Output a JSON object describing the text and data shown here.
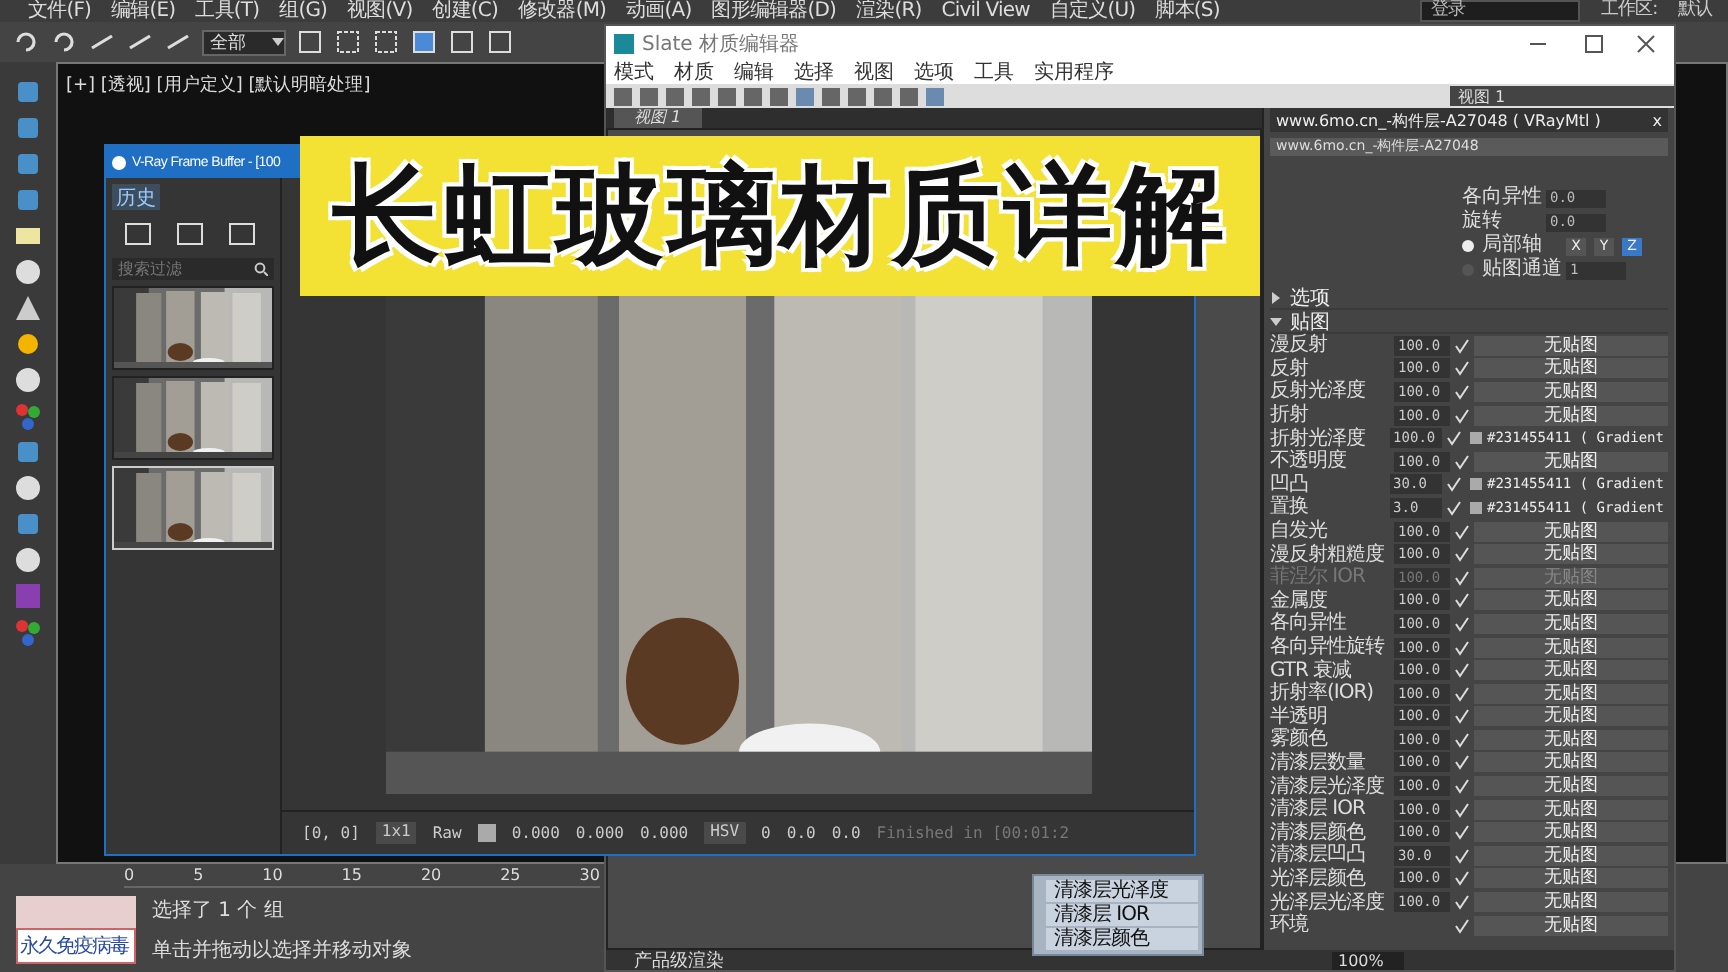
{
  "menu_bar": [
    "文件(F)",
    "编辑(E)",
    "工具(T)",
    "组(G)",
    "视图(V)",
    "创建(C)",
    "修改器(M)",
    "动画(A)",
    "图形编辑器(D)",
    "渲染(R)",
    "Civil View",
    "自定义(U)",
    "脚本(S)"
  ],
  "login_field": {
    "placeholder": "登录"
  },
  "workspace": {
    "label": "工作区:",
    "value": "默认"
  },
  "toolbar": {
    "selection_filter": "全部"
  },
  "viewport": {
    "label": "[+] [透视] [用户定义] [默认明暗处理]"
  },
  "slate_editor": {
    "title": "Slate 材质编辑器",
    "menu": [
      "模式",
      "材质",
      "编辑",
      "选择",
      "视图",
      "选项",
      "工具",
      "实用程序"
    ],
    "view_select": "视图 1",
    "tabs": [
      {
        "label": "视图 1",
        "selected": true
      }
    ],
    "node_rows": [
      "清漆层光泽度",
      "清漆层 IOR",
      "清漆层颜色"
    ],
    "render_mode": "产品级渲染",
    "zoom": "100%",
    "params": {
      "title": "www.6mo.cn_-构件层-A27048 ( VRayMtl )",
      "close": "x",
      "name": "www.6mo.cn_-构件层-A27048",
      "fields": [
        {
          "label": "各向异性",
          "value": "0.0"
        },
        {
          "label": "旋转",
          "value": "0.0"
        }
      ],
      "axis_options": [
        {
          "label": "局部轴",
          "selected": true
        },
        {
          "label": "贴图通道",
          "selected": false
        }
      ],
      "channel": "1",
      "axes": [
        {
          "label": "X",
          "selected": false
        },
        {
          "label": "Y",
          "selected": false
        },
        {
          "label": "Z",
          "selected": true
        }
      ],
      "sections": [
        {
          "title": "选项",
          "expanded": false
        },
        {
          "title": "贴图",
          "expanded": true
        }
      ],
      "maps": [
        {
          "name": "漫反射",
          "amount": "100.0",
          "checked": true,
          "kind": "empty",
          "map": "无贴图",
          "disabled": false
        },
        {
          "name": "反射",
          "amount": "100.0",
          "checked": true,
          "kind": "empty",
          "map": "无贴图",
          "disabled": false
        },
        {
          "name": "反射光泽度",
          "amount": "100.0",
          "checked": true,
          "kind": "empty",
          "map": "无贴图",
          "disabled": false
        },
        {
          "name": "折射",
          "amount": "100.0",
          "checked": true,
          "kind": "empty",
          "map": "无贴图",
          "disabled": false
        },
        {
          "name": "折射光泽度",
          "amount": "100.0",
          "checked": true,
          "kind": "texture",
          "map": "#231455411 ( Gradient",
          "disabled": false
        },
        {
          "name": "不透明度",
          "amount": "100.0",
          "checked": true,
          "kind": "empty",
          "map": "无贴图",
          "disabled": false
        },
        {
          "name": "凹凸",
          "amount": "30.0",
          "checked": true,
          "kind": "texture",
          "map": "#231455411 ( Gradient",
          "disabled": false
        },
        {
          "name": "置换",
          "amount": "3.0",
          "checked": true,
          "kind": "texture",
          "map": "#231455411 ( Gradient",
          "disabled": false
        },
        {
          "name": "自发光",
          "amount": "100.0",
          "checked": true,
          "kind": "empty",
          "map": "无贴图",
          "disabled": false
        },
        {
          "name": "漫反射粗糙度",
          "amount": "100.0",
          "checked": true,
          "kind": "empty",
          "map": "无贴图",
          "disabled": false
        },
        {
          "name": "菲涅尔 IOR",
          "amount": "100.0",
          "checked": true,
          "kind": "empty",
          "map": "无贴图",
          "disabled": true
        },
        {
          "name": "金属度",
          "amount": "100.0",
          "checked": true,
          "kind": "empty",
          "map": "无贴图",
          "disabled": false
        },
        {
          "name": "各向异性",
          "amount": "100.0",
          "checked": true,
          "kind": "empty",
          "map": "无贴图",
          "disabled": false
        },
        {
          "name": "各向异性旋转",
          "amount": "100.0",
          "checked": true,
          "kind": "empty",
          "map": "无贴图",
          "disabled": false
        },
        {
          "name": "GTR 衰减",
          "amount": "100.0",
          "checked": true,
          "kind": "empty",
          "map": "无贴图",
          "disabled": false
        },
        {
          "name": "折射率(IOR)",
          "amount": "100.0",
          "checked": true,
          "kind": "empty",
          "map": "无贴图",
          "disabled": false
        },
        {
          "name": "半透明",
          "amount": "100.0",
          "checked": true,
          "kind": "empty",
          "map": "无贴图",
          "disabled": false
        },
        {
          "name": "雾颜色",
          "amount": "100.0",
          "checked": true,
          "kind": "empty",
          "map": "无贴图",
          "disabled": false
        },
        {
          "name": "清漆层数量",
          "amount": "100.0",
          "checked": true,
          "kind": "empty",
          "map": "无贴图",
          "disabled": false
        },
        {
          "name": "清漆层光泽度",
          "amount": "100.0",
          "checked": true,
          "kind": "empty",
          "map": "无贴图",
          "disabled": false
        },
        {
          "name": "清漆层 IOR",
          "amount": "100.0",
          "checked": true,
          "kind": "empty",
          "map": "无贴图",
          "disabled": false
        },
        {
          "name": "清漆层颜色",
          "amount": "100.0",
          "checked": true,
          "kind": "empty",
          "map": "无贴图",
          "disabled": false
        },
        {
          "name": "清漆层凹凸",
          "amount": "30.0",
          "checked": true,
          "kind": "empty",
          "map": "无贴图",
          "disabled": false
        },
        {
          "name": "光泽层颜色",
          "amount": "100.0",
          "checked": true,
          "kind": "empty",
          "map": "无贴图",
          "disabled": false
        },
        {
          "name": "光泽层光泽度",
          "amount": "100.0",
          "checked": true,
          "kind": "empty",
          "map": "无贴图",
          "disabled": false
        },
        {
          "name": "环境",
          "checked": true,
          "kind": "empty",
          "map": "无贴图",
          "disabled": false
        }
      ]
    }
  },
  "frame_buffer": {
    "title": "V-Ray Frame Buffer - [100",
    "history_tab": "历史",
    "search": {
      "placeholder": "搜索过滤"
    },
    "history": [
      {
        "kind": "picture",
        "selected": false
      },
      {
        "kind": "picture",
        "selected": false
      },
      {
        "kind": "picture",
        "selected": true
      }
    ],
    "coords": "[0, 0]",
    "zoom": "1x1",
    "raw": "Raw",
    "rgb": [
      "0.000",
      "0.000",
      "0.000"
    ],
    "color_space": "HSV",
    "hsv": [
      "0",
      "0.0",
      "0.0"
    ],
    "status": "Finished in [00:01:2"
  },
  "banner": "长虹玻璃材质详解",
  "timeline": {
    "ticks": [
      "0",
      "5",
      "10",
      "15",
      "20",
      "25",
      "30"
    ]
  },
  "status": {
    "selection": "选择了 1 个 组",
    "hint": "单击并拖动以选择并移动对象",
    "badge": "永久免疫病毒"
  }
}
